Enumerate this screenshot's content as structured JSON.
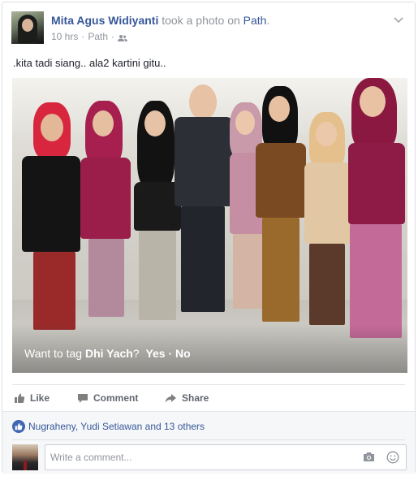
{
  "post": {
    "author": "Mita Agus Widiyanti",
    "action_text": "took a photo on",
    "app_name": "Path",
    "app_suffix": ".",
    "time": "10 hrs",
    "via": "Path",
    "dot": "·",
    "body": ".kita tadi siang.. ala2 kartini gitu.."
  },
  "photo": {
    "tag_prompt": "Want to tag",
    "tag_name": "Dhi Yach",
    "tag_question": "?",
    "tag_yes": "Yes",
    "tag_sep": "·",
    "tag_no": "No"
  },
  "actions": {
    "like": "Like",
    "comment": "Comment",
    "share": "Share"
  },
  "feedback": {
    "likers": "Nugraheny, Yudi Setiawan and 13 others",
    "comment_placeholder": "Write a comment..."
  },
  "icons": {
    "menu": "chevron-down-icon",
    "audience": "friends-icon",
    "like": "thumbs-up-icon",
    "comment": "speech-bubble-icon",
    "share": "share-arrow-icon",
    "like_reaction": "like-reaction-icon",
    "camera": "camera-icon",
    "emoji": "smiley-icon"
  },
  "colors": {
    "link": "#365899",
    "muted": "#90949c",
    "like_blue": "#4267b2"
  }
}
